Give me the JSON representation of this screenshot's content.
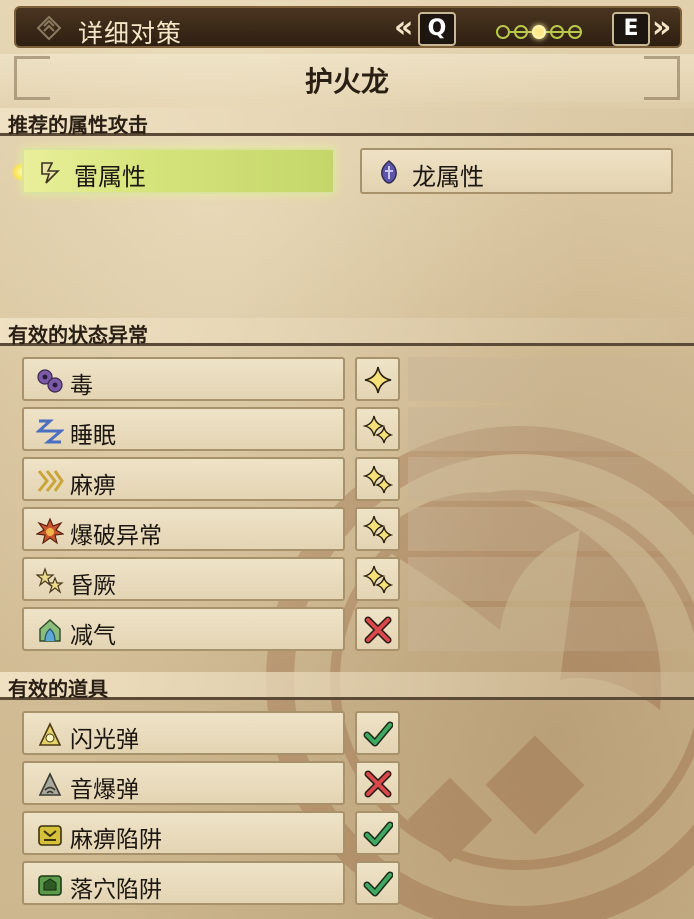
{
  "header": {
    "title": "详细对策",
    "prev_key": "Q",
    "next_key": "E",
    "prev_chevron": "«",
    "next_chevron": "»",
    "page_count": 5,
    "active_page": 3
  },
  "monster": {
    "name": "护火龙"
  },
  "elements": {
    "heading": "推荐的属性攻击",
    "items": [
      {
        "label": "雷属性",
        "icon": "thunder-icon",
        "selected": true
      },
      {
        "label": "龙属性",
        "icon": "dragon-icon",
        "selected": false
      }
    ]
  },
  "ailments": {
    "heading": "有效的状态异常",
    "items": [
      {
        "label": "毒",
        "icon": "poison-icon",
        "stars": 1
      },
      {
        "label": "睡眠",
        "icon": "sleep-icon",
        "stars": 2
      },
      {
        "label": "麻痹",
        "icon": "paralysis-icon",
        "stars": 2
      },
      {
        "label": "爆破异常",
        "icon": "blast-icon",
        "stars": 2
      },
      {
        "label": "昏厥",
        "icon": "stun-icon",
        "stars": 2
      },
      {
        "label": "减气",
        "icon": "exhaust-icon",
        "stars": 0
      }
    ]
  },
  "items": {
    "heading": "有效的道具",
    "list": [
      {
        "label": "闪光弹",
        "icon": "flash-pod-icon",
        "effective": true
      },
      {
        "label": "音爆弹",
        "icon": "sonic-bomb-icon",
        "effective": false
      },
      {
        "label": "麻痹陷阱",
        "icon": "shock-trap-icon",
        "effective": true
      },
      {
        "label": "落穴陷阱",
        "icon": "pitfall-trap-icon",
        "effective": true
      }
    ]
  },
  "colors": {
    "check": "#3fa860",
    "cross": "#d9484a",
    "star": "#f6e07a",
    "selected_element": "#d6e47c"
  }
}
